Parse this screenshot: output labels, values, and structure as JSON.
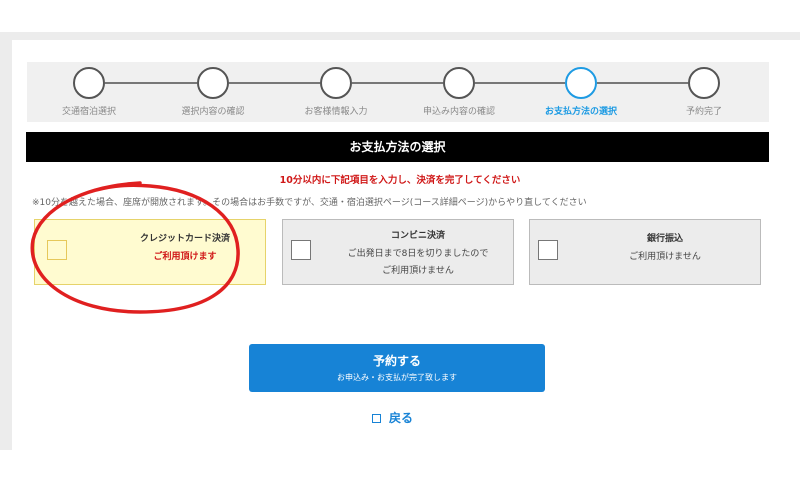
{
  "steps": [
    {
      "label": "交通宿泊選択",
      "active": false
    },
    {
      "label": "選択内容の確認",
      "active": false
    },
    {
      "label": "お客様情報入力",
      "active": false
    },
    {
      "label": "申込み内容の確認",
      "active": false
    },
    {
      "label": "お支払方法の選択",
      "active": true
    },
    {
      "label": "予約完了",
      "active": false
    }
  ],
  "section_title": "お支払方法の選択",
  "warning": "10分以内に下記項目を入力し、決済を完了してください",
  "note": "※10分を越えた場合、座席が開放されます。その場合はお手数ですが、交通・宿泊選択ページ(コース詳細ページ)からやり直してください",
  "payment_options": [
    {
      "title": "クレジットカード決済",
      "sub1": "ご利用頂けます",
      "sub2": "",
      "selected": true
    },
    {
      "title": "コンビニ決済",
      "sub1": "ご出発日まで8日を切りましたので",
      "sub2": "ご利用頂けません",
      "selected": false
    },
    {
      "title": "銀行振込",
      "sub1": "ご利用頂けません",
      "sub2": "",
      "selected": false
    }
  ],
  "reserve_button": {
    "label": "予約する",
    "sub": "お申込み・お支払が完了致します"
  },
  "back_link": "戻る",
  "colors": {
    "accent": "#1e9be3",
    "button": "#1783d6",
    "warning": "#d01818",
    "annotation": "#e02020"
  }
}
